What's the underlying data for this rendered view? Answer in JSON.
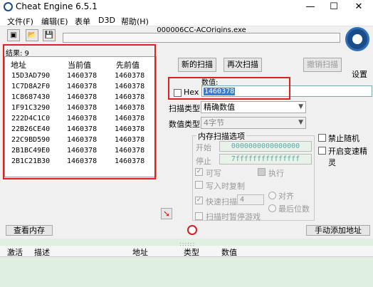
{
  "window": {
    "title": "Cheat Engine 6.5.1",
    "minimize": "—",
    "maximize": "☐",
    "close": "✕"
  },
  "menu": [
    "文件(F)",
    "编辑(E)",
    "表单",
    "D3D",
    "帮助(H)"
  ],
  "toolbar": {
    "process": "000006CC-ACOrigins.exe"
  },
  "results": {
    "label": "结果: 9"
  },
  "columns": {
    "address": "地址",
    "current": "当前值",
    "previous": "先前值"
  },
  "rows": [
    {
      "address": "15D3AD790",
      "current": "1460378",
      "previous": "1460378"
    },
    {
      "address": "1C7D8A2F0",
      "current": "1460378",
      "previous": "1460378"
    },
    {
      "address": "1C8687430",
      "current": "1460378",
      "previous": "1460378"
    },
    {
      "address": "1F91C3290",
      "current": "1460378",
      "previous": "1460378"
    },
    {
      "address": "222D4C1C0",
      "current": "1460378",
      "previous": "1460378"
    },
    {
      "address": "22B26CE40",
      "current": "1460378",
      "previous": "1460378"
    },
    {
      "address": "22C9BD590",
      "current": "1460378",
      "previous": "1460378"
    },
    {
      "address": "2B1BC49E0",
      "current": "1460378",
      "previous": "1460378"
    },
    {
      "address": "2B1C21B30",
      "current": "1460378",
      "previous": "1460378"
    }
  ],
  "buttons": {
    "new_scan": "新的扫描",
    "next_scan": "再次扫描",
    "undo_scan": "撤销扫描",
    "settings": "设置",
    "view_memory": "查看内存",
    "add_address": "手动添加地址"
  },
  "value": {
    "label": "数值:",
    "hex_label": "Hex",
    "input": "1460378"
  },
  "scan_type": {
    "label": "扫描类型",
    "value": "精确数值"
  },
  "value_type": {
    "label": "数值类型",
    "value": "4字节"
  },
  "mem_options": {
    "title": "内存扫描选项",
    "start_label": "开始",
    "start_value": "0000000000000000",
    "stop_label": "停止",
    "stop_value": "7fffffffffffffff",
    "writable": "可写",
    "executable": "执行",
    "copy_on_write": "写入时复制",
    "fast_scan": "快速扫描",
    "fast_value": "4",
    "align": "对齐",
    "last_digits": "最后位数",
    "pause": "扫描时暂停游戏"
  },
  "options": {
    "disable_random": "禁止随机",
    "speedhack": "开启变速精灵"
  },
  "table_columns": {
    "active": "激活",
    "description": "描述",
    "address": "地址",
    "type": "类型",
    "value": "数值"
  },
  "icons": {
    "logo": "ce-logo-icon",
    "red_arrow": "arrow-icon",
    "stop": "stop-icon"
  }
}
